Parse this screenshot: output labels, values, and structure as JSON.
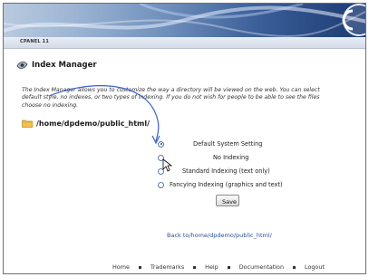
{
  "header": {
    "brand": "CPANEL 11"
  },
  "page": {
    "title": "Index Manager",
    "description_lines": [
      "The Index Manager allows you to customize the way a directory will be viewed on the web. You can select",
      "default style, no indexes, or two types of indexing. If you do not wish for people to be able to see the files",
      "choose no indexing."
    ],
    "path": "/home/dpdemo/public_html/"
  },
  "options": [
    {
      "label": "Default System Setting",
      "checked": true
    },
    {
      "label": "No Indexing",
      "checked": false
    },
    {
      "label": "Standard Indexing (text only)",
      "checked": false
    },
    {
      "label": "Fancying Indexing (graphics and text)",
      "checked": false
    }
  ],
  "save_label": "Save",
  "back_link": "Back to/home/dpdemo/public_html/",
  "footer": {
    "links": [
      "Home",
      "Trademarks",
      "Help",
      "Documentation",
      "Logout"
    ]
  },
  "icons": {
    "title_icon": "eye-icon",
    "path_icon": "folder-icon",
    "cursor": "mouse-pointer-icon"
  },
  "colors": {
    "link": "#2a4f8f",
    "annotation": "#3a5fd0"
  }
}
